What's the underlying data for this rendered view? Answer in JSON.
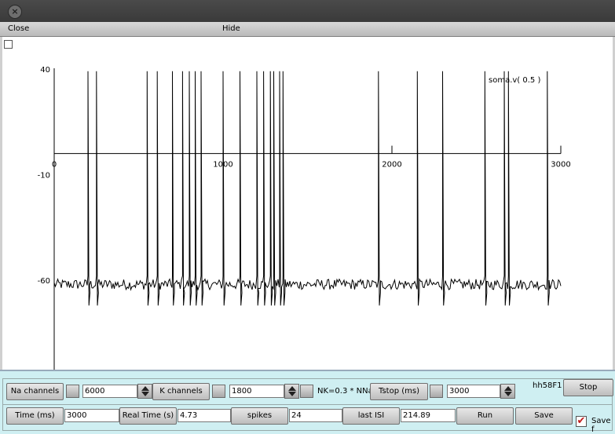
{
  "window": {
    "close_glyph": "×"
  },
  "menu": {
    "close": "Close",
    "hide": "Hide"
  },
  "chart_data": {
    "type": "line",
    "series_label": "soma.v( 0.5 )",
    "xlim": [
      0,
      3000
    ],
    "ylim": [
      -90,
      40
    ],
    "x_ticks": [
      "0",
      "1000",
      "2000",
      "3000"
    ],
    "y_ticks": [
      "40",
      "-10",
      "-60"
    ],
    "baseline": -62,
    "spike_times": [
      200,
      250,
      550,
      610,
      700,
      760,
      800,
      835,
      870,
      1000,
      1100,
      1200,
      1240,
      1280,
      1300,
      1335,
      1355,
      1920,
      2150,
      2300,
      2550,
      2665,
      2690,
      2920
    ],
    "colors": {
      "trace": "#000000",
      "axis": "#000000"
    }
  },
  "controls": {
    "row1": {
      "na_button": "Na channels",
      "na_value": "6000",
      "k_button": "K channels",
      "k_value": "1800",
      "nk_label": "NK=0.3 * NNa",
      "tstop_button": "Tstop (ms)",
      "tstop_value": "3000",
      "hh_label": "hh58F1",
      "stop_button": "Stop"
    },
    "row2": {
      "time_button": "Time (ms)",
      "time_value": "3000",
      "realtime_button": "Real Time (s)",
      "realtime_value": "4.73",
      "spikes_button": "spikes",
      "spikes_value": "24",
      "isi_button": "last ISI",
      "isi_value": "214.89",
      "run_button": "Run",
      "save_button": "Save",
      "save_check_label": "Save f",
      "save_check_glyph": "✔"
    }
  }
}
